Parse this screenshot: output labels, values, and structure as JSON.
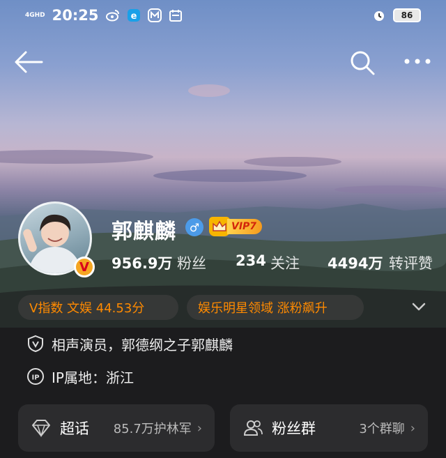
{
  "status_bar": {
    "network": "4GHD",
    "time": "20:25",
    "battery": "86",
    "icons": [
      "weibo-icon",
      "app-e-icon",
      "app-m-icon",
      "calendar-icon",
      "alarm-icon"
    ]
  },
  "topbar": {
    "icons": [
      "back-arrow-icon",
      "search-icon",
      "more-icon"
    ]
  },
  "profile": {
    "name": "郭麒麟",
    "gender_symbol": "♂",
    "vip_label": "VIP7",
    "verified_mark": "V",
    "stats": [
      {
        "value": "956.9万",
        "label": "粉丝"
      },
      {
        "value": "234",
        "label": "关注"
      },
      {
        "value": "4494万",
        "label": "转评赞"
      }
    ]
  },
  "tags": [
    "V指数 文娱 44.53分",
    "娱乐明星领域 涨粉飙升"
  ],
  "info": {
    "description": "相声演员，郭德纲之子郭麒麟",
    "ip_location": "IP属地：浙江"
  },
  "cards": [
    {
      "title": "超话",
      "value": "85.7万护林军",
      "arrow": "›",
      "icon": "diamond-icon"
    },
    {
      "title": "粉丝群",
      "value": "3个群聊",
      "arrow": "›",
      "icon": "group-icon"
    }
  ],
  "colors": {
    "accent_orange": "#ff8a00",
    "background": "#1c1c1e",
    "card": "#2c2c2e",
    "gender_blue": "#4c9be8"
  }
}
